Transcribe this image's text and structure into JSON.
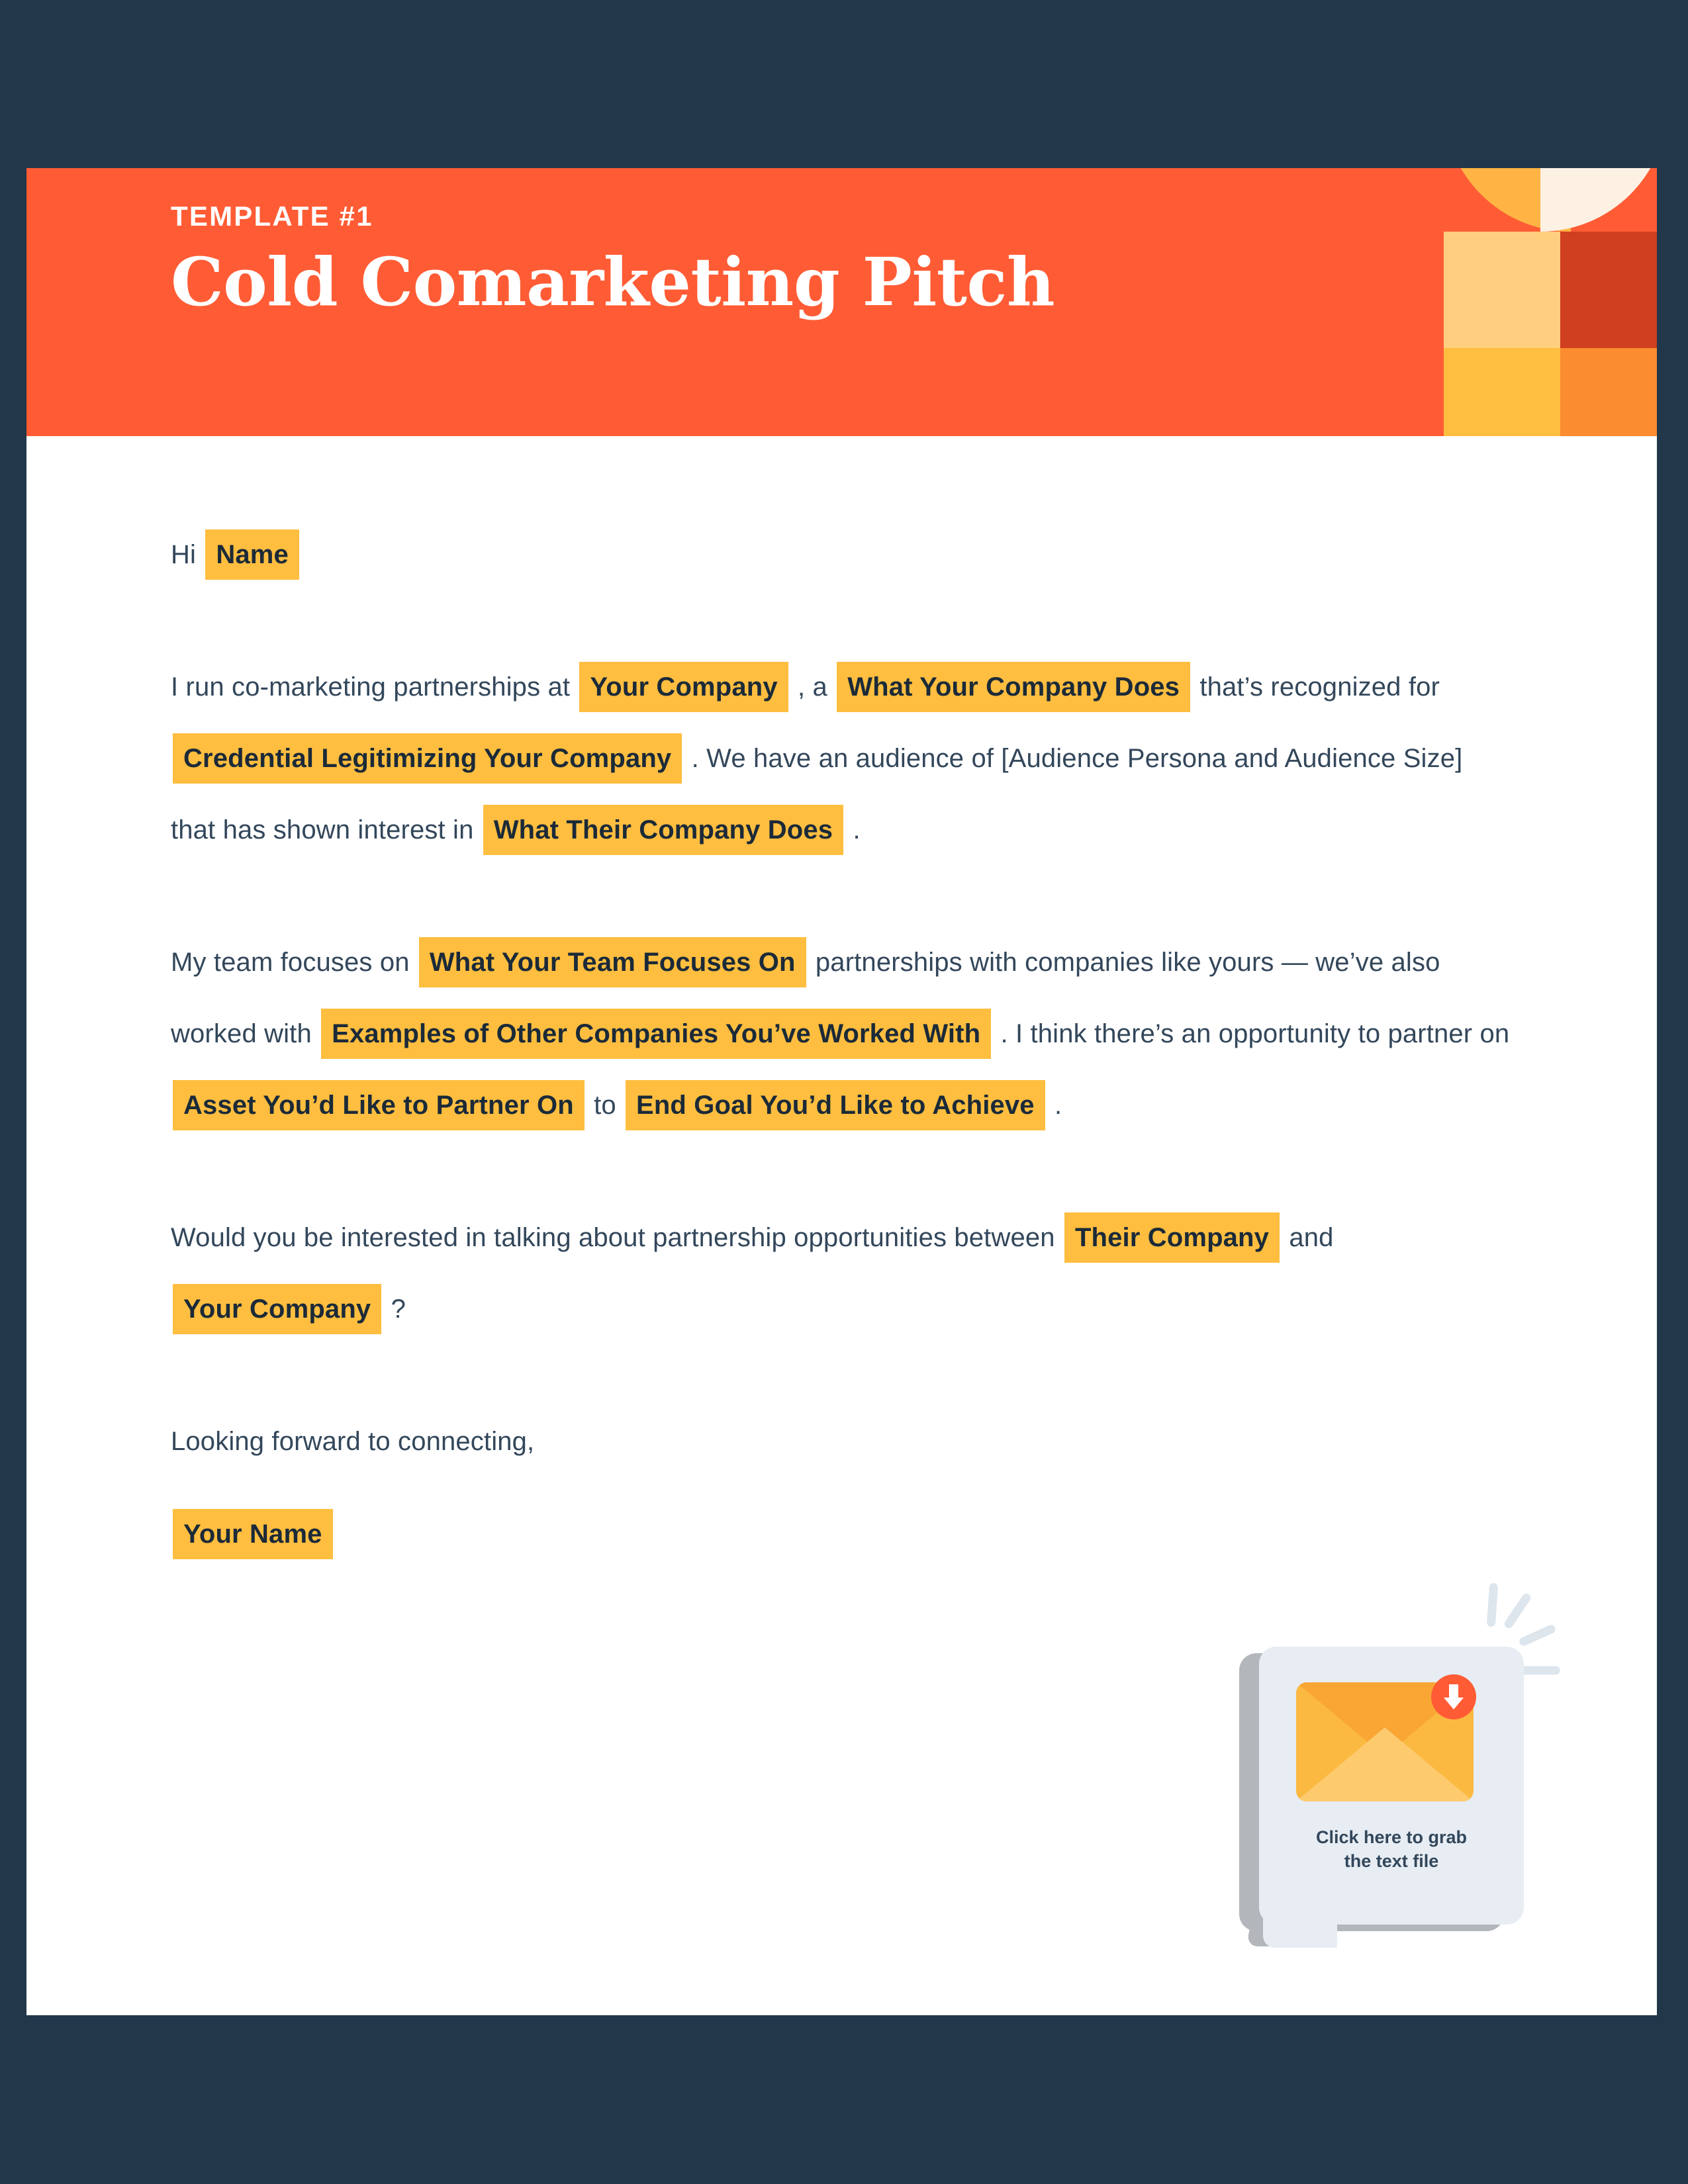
{
  "page": {
    "background_color": "#22374a",
    "card_background": "#ffffff"
  },
  "header": {
    "background_color": "#ff5c35",
    "eyebrow": "TEMPLATE #1",
    "title": "Cold Comarketing Pitch",
    "decoration": {
      "quarter_circle_left_color": "#ffb443",
      "quarter_circle_right_color": "#fdf1e4",
      "square_top_left_color": "#ffce7e",
      "square_top_right_color": "#cf3f20",
      "square_bottom_left_color": "#ffbe40",
      "square_bottom_right_color": "#fb8c30"
    }
  },
  "letter": {
    "highlight_color": "#ffbe40",
    "text_color": "#33475b",
    "greeting": {
      "prefix": "Hi",
      "field": "Name"
    },
    "paragraph_1": {
      "t1": "I run co-marketing partnerships at",
      "f1": "Your Company",
      "t2": ", a",
      "f2": "What Your Company Does",
      "t3": "that’s recognized for",
      "f3": "Credential Legitimizing Your Company",
      "t4": ". We have an audience of [Audience Persona and Audience Size]",
      "t5": "that has shown interest in",
      "f4": "What Their Company Does",
      "t6": "."
    },
    "paragraph_2": {
      "t1": "My team focuses on",
      "f1": "What Your Team Focuses On",
      "t2": "partnerships with companies like yours — we’ve also worked with",
      "f2": "Examples of Other Companies You’ve Worked With",
      "t3": ". I think there’s an opportunity to partner on",
      "f3": "Asset You’d Like to Partner On",
      "t4": "to",
      "f4": "End Goal You’d Like to Achieve",
      "t5": "."
    },
    "paragraph_3": {
      "t1": "Would you be interested in talking about partnership opportunities between",
      "f1": "Their Company",
      "t2": "and",
      "f2": "Your Company",
      "t3": "?"
    },
    "closing": {
      "line": "Looking forward to connecting,",
      "signature_field": "Your Name"
    }
  },
  "download_cta": {
    "caption_line_1": "Click here to grab",
    "caption_line_2": "the text file",
    "badge_icon": "download-arrow-icon",
    "badge_color": "#ff5c35",
    "envelope_color": "#fcb942",
    "bubble_color": "#e7edf3"
  }
}
